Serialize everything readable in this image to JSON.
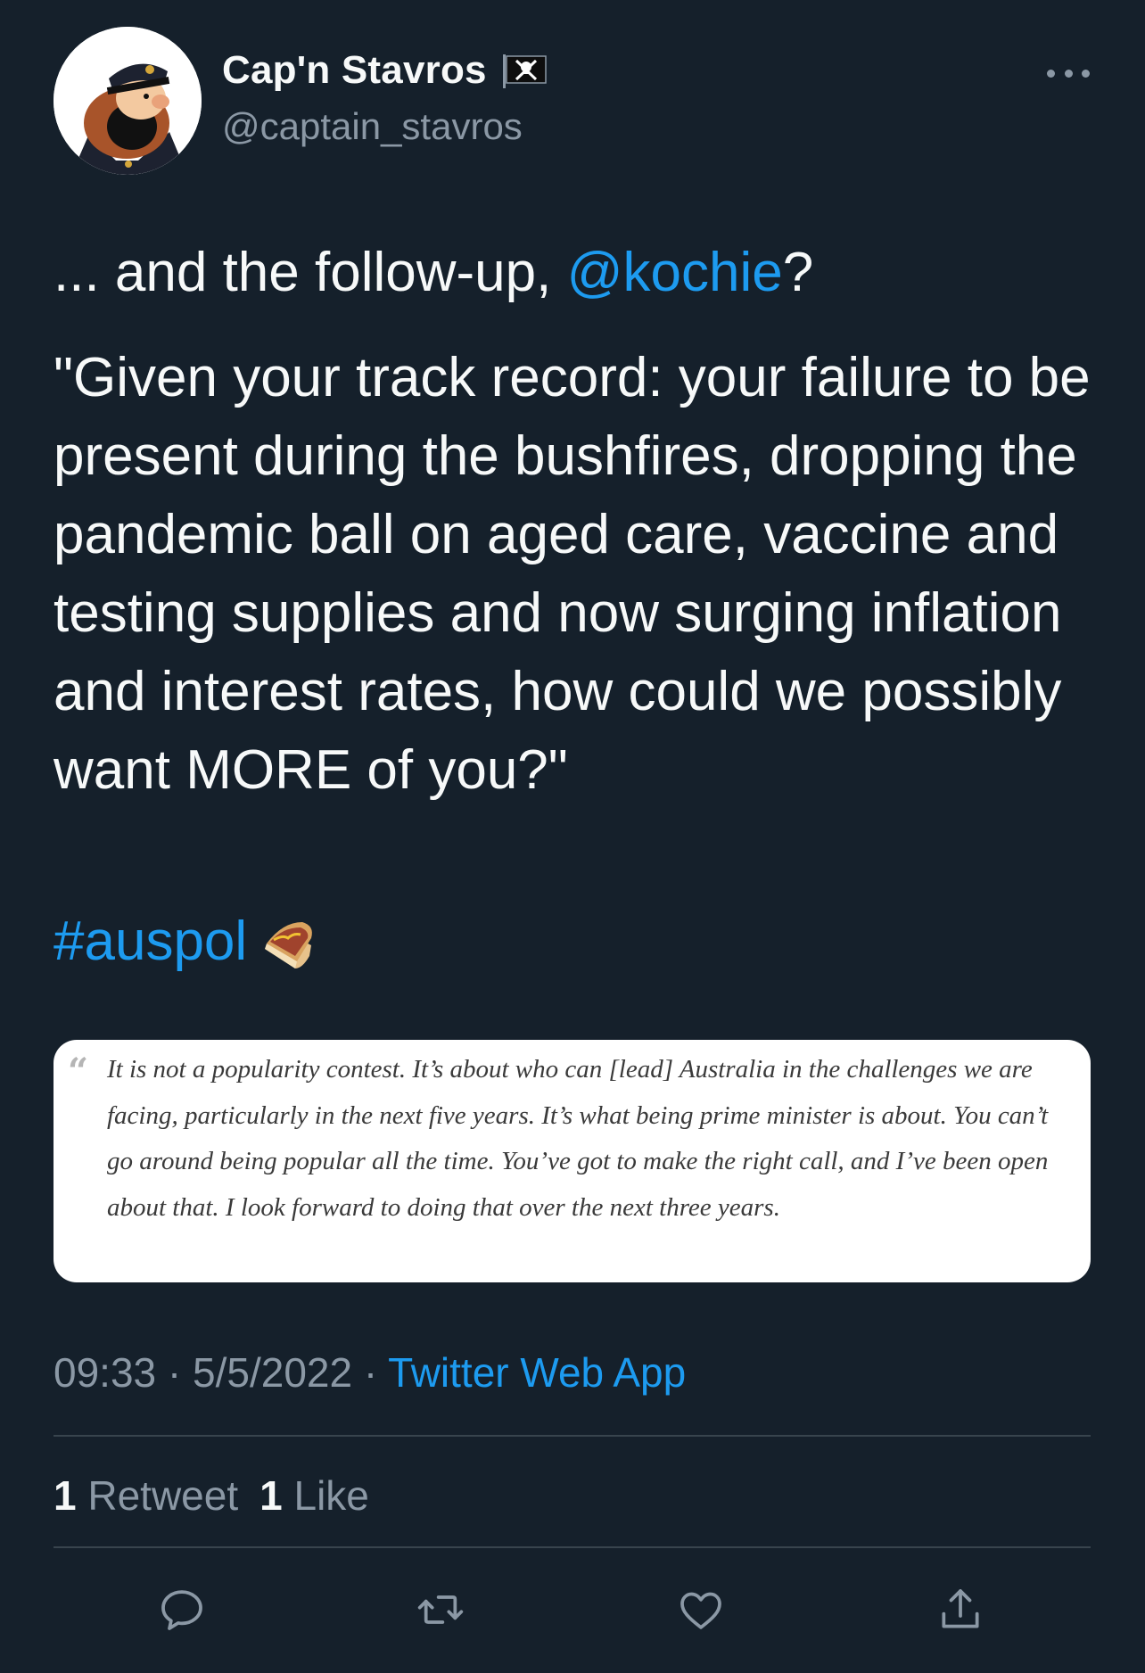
{
  "author": {
    "display_name": "Cap'n Stavros",
    "handle": "@captain_stavros",
    "flag_icon": "pirate-flag-icon"
  },
  "tweet": {
    "line1_prefix": "... and the follow-up, ",
    "mention": "@kochie",
    "line1_suffix": "?",
    "quote_text": "\"Given your track record: your failure to be present during the bushfires, dropping the pandemic ball on aged care, vaccine and testing supplies and now surging inflation and interest rates, how could we possibly want MORE of you?\"",
    "hashtag": "#auspol",
    "emoji": "sandwich-emoji"
  },
  "quote_card": {
    "quote_mark": "“",
    "text": "It is not a popularity contest. It’s about who can [lead] Australia in the challenges we are facing, particularly in the next five years. It’s what being prime minister is about. You can’t go around being popular all the time. You’ve got to make the right call, and I’ve been open about that. I look forward to doing that over the next three years."
  },
  "meta": {
    "time": "09:33",
    "separator1": " · ",
    "date": "5/5/2022",
    "separator2": " · ",
    "source": "Twitter Web App"
  },
  "stats": {
    "retweet_count": "1",
    "retweet_label": " Retweet",
    "like_count": "1",
    "like_label": " Like"
  },
  "actions": [
    "reply-icon",
    "retweet-icon",
    "like-icon",
    "share-icon"
  ],
  "colors": {
    "background": "#15202b",
    "text": "#f7f9f9",
    "secondary": "#8b98a5",
    "link": "#1d9bf0",
    "divider": "#38444d"
  }
}
